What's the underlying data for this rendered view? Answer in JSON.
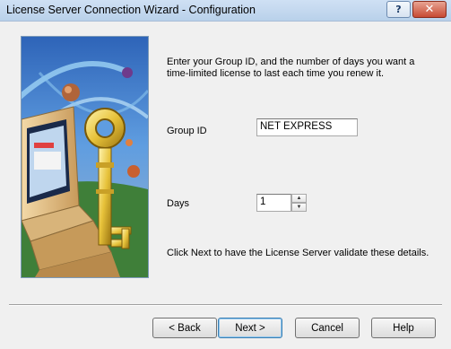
{
  "window": {
    "title": "License Server Connection Wizard - Configuration",
    "help_glyph": "?",
    "close_glyph": "✕"
  },
  "content": {
    "intro_line1": "Enter your Group ID, and the number of days you want a",
    "intro_line2": "time-limited license to last each time you renew it.",
    "group_label": "Group ID",
    "group_value": "NET EXPRESS",
    "days_label": "Days",
    "days_value": "1",
    "hint": "Click Next to have the License Server validate these details."
  },
  "buttons": {
    "back": "< Back",
    "next": "Next >",
    "cancel": "Cancel",
    "help": "Help"
  },
  "icons": {
    "spin_up": "▲",
    "spin_down": "▼",
    "wizard_image": "key-and-computer-illustration"
  }
}
